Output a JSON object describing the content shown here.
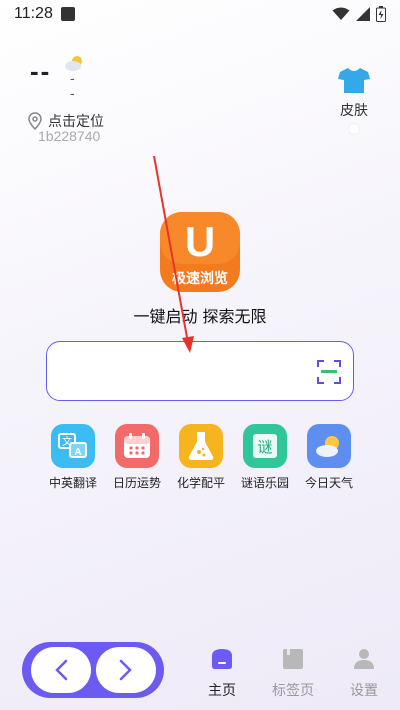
{
  "status_bar": {
    "time": "11:28"
  },
  "weather": {
    "temp": "--",
    "temp_sub": "--",
    "icon": "partly-cloudy-icon"
  },
  "location": {
    "label": "点击定位",
    "device_id": "1b228740"
  },
  "skin": {
    "label": "皮肤"
  },
  "logo": {
    "text": "极速浏览",
    "letter": "U"
  },
  "slogan": "一键启动 探索无限",
  "search": {
    "value": "",
    "placeholder": ""
  },
  "quick_links": [
    {
      "label": "中英翻译",
      "icon": "translate-icon",
      "color": "#3bbcf2"
    },
    {
      "label": "日历运势",
      "icon": "calendar-icon",
      "color": "#f26a6a"
    },
    {
      "label": "化学配平",
      "icon": "flask-icon",
      "color": "#f6b51e"
    },
    {
      "label": "谜语乐园",
      "icon": "riddle-icon",
      "color": "#2fc79a"
    },
    {
      "label": "今日天气",
      "icon": "weather-icon",
      "color": "#5e8ff0"
    }
  ],
  "riddle_char": "谜",
  "translate_chars": {
    "a": "文",
    "b": "A"
  },
  "bottom_nav": {
    "accent": "#6b5bf2",
    "tabs": [
      {
        "label": "主页",
        "active": true
      },
      {
        "label": "标签页",
        "active": false
      },
      {
        "label": "设置",
        "active": false
      }
    ]
  }
}
